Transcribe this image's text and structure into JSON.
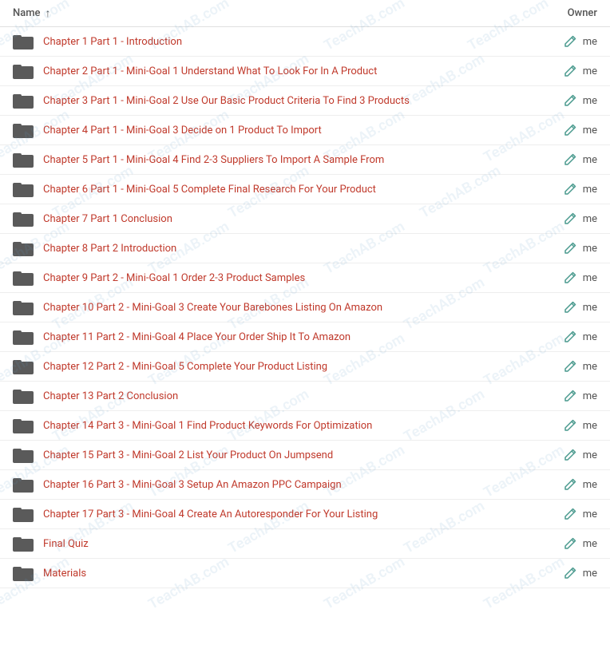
{
  "header": {
    "name_label": "Name",
    "owner_label": "Owner",
    "sort_direction": "↑"
  },
  "rows": [
    {
      "id": 1,
      "title": "Chapter 1 Part 1 - Introduction",
      "owner": "me"
    },
    {
      "id": 2,
      "title": "Chapter 2 Part 1 - Mini-Goal 1 Understand What To Look For In A Product",
      "owner": "me"
    },
    {
      "id": 3,
      "title": "Chapter 3 Part 1 - Mini-Goal 2 Use Our Basic Product Criteria To Find 3 Products",
      "owner": "me"
    },
    {
      "id": 4,
      "title": "Chapter 4 Part 1 - Mini-Goal 3 Decide on 1 Product To Import",
      "owner": "me"
    },
    {
      "id": 5,
      "title": "Chapter 5 Part 1 - Mini-Goal 4 Find 2-3 Suppliers To Import A Sample From",
      "owner": "me"
    },
    {
      "id": 6,
      "title": "Chapter 6 Part 1 - Mini-Goal 5 Complete Final Research For Your Product",
      "owner": "me"
    },
    {
      "id": 7,
      "title": "Chapter 7 Part 1 Conclusion",
      "owner": "me"
    },
    {
      "id": 8,
      "title": "Chapter 8 Part 2 Introduction",
      "owner": "me"
    },
    {
      "id": 9,
      "title": "Chapter 9 Part 2 - Mini-Goal 1 Order 2-3 Product Samples",
      "owner": "me"
    },
    {
      "id": 10,
      "title": "Chapter 10 Part 2 - Mini-Goal 3 Create Your Barebones Listing On Amazon",
      "owner": "me"
    },
    {
      "id": 11,
      "title": "Chapter 11 Part 2 - Mini-Goal 4 Place Your Order Ship It To Amazon",
      "owner": "me"
    },
    {
      "id": 12,
      "title": "Chapter 12 Part 2 - Mini-Goal 5 Complete Your Product Listing",
      "owner": "me"
    },
    {
      "id": 13,
      "title": "Chapter 13 Part 2 Conclusion",
      "owner": "me"
    },
    {
      "id": 14,
      "title": "Chapter 14 Part 3 - Mini-Goal 1 Find Product Keywords For Optimization",
      "owner": "me"
    },
    {
      "id": 15,
      "title": "Chapter 15 Part 3 - Mini-Goal 2 List Your Product On Jumpsend",
      "owner": "me"
    },
    {
      "id": 16,
      "title": "Chapter 16 Part 3 - Mini-Goal 3 Setup An Amazon PPC Campaign",
      "owner": "me"
    },
    {
      "id": 17,
      "title": "Chapter 17 Part 3 - Mini-Goal 4 Create An Autoresponder For Your Listing",
      "owner": "me"
    },
    {
      "id": 18,
      "title": "Final Quiz",
      "owner": "me"
    },
    {
      "id": 19,
      "title": "Materials",
      "owner": "me"
    }
  ],
  "watermark_text": "TeachAB.com"
}
